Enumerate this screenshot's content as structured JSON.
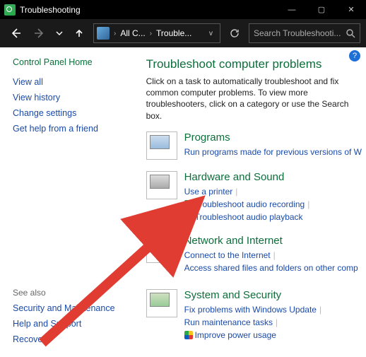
{
  "window": {
    "title": "Troubleshooting",
    "min": "—",
    "max": "▢",
    "close": "✕"
  },
  "nav": {
    "crumb1": "All C...",
    "crumb2": "Trouble...",
    "search_placeholder": "Search Troubleshooti..."
  },
  "sidebar": {
    "home": "Control Panel Home",
    "links": [
      "View all",
      "View history",
      "Change settings",
      "Get help from a friend"
    ],
    "seealso_label": "See also",
    "seealso": [
      "Security and Maintenance",
      "Help and Support",
      "Recovery"
    ]
  },
  "main": {
    "heading": "Troubleshoot computer problems",
    "intro": "Click on a task to automatically troubleshoot and fix common computer problems. To view more troubleshooters, click on a category or use the Search box.",
    "categories": [
      {
        "title": "Programs",
        "links": [
          {
            "label": "Run programs made for previous versions of W",
            "shield": false
          }
        ]
      },
      {
        "title": "Hardware and Sound",
        "links": [
          {
            "label": "Use a printer",
            "shield": false
          },
          {
            "label": "Troubleshoot audio recording",
            "shield": true
          },
          {
            "label": "Troubleshoot audio playback",
            "shield": true
          }
        ]
      },
      {
        "title": "Network and Internet",
        "links": [
          {
            "label": "Connect to the Internet",
            "shield": false
          },
          {
            "label": "Access shared files and folders on other comp",
            "shield": false
          }
        ]
      },
      {
        "title": "System and Security",
        "links": [
          {
            "label": "Fix problems with Windows Update",
            "shield": false
          },
          {
            "label": "Run maintenance tasks",
            "shield": false
          },
          {
            "label": "Improve power usage",
            "shield": true
          }
        ]
      }
    ]
  }
}
